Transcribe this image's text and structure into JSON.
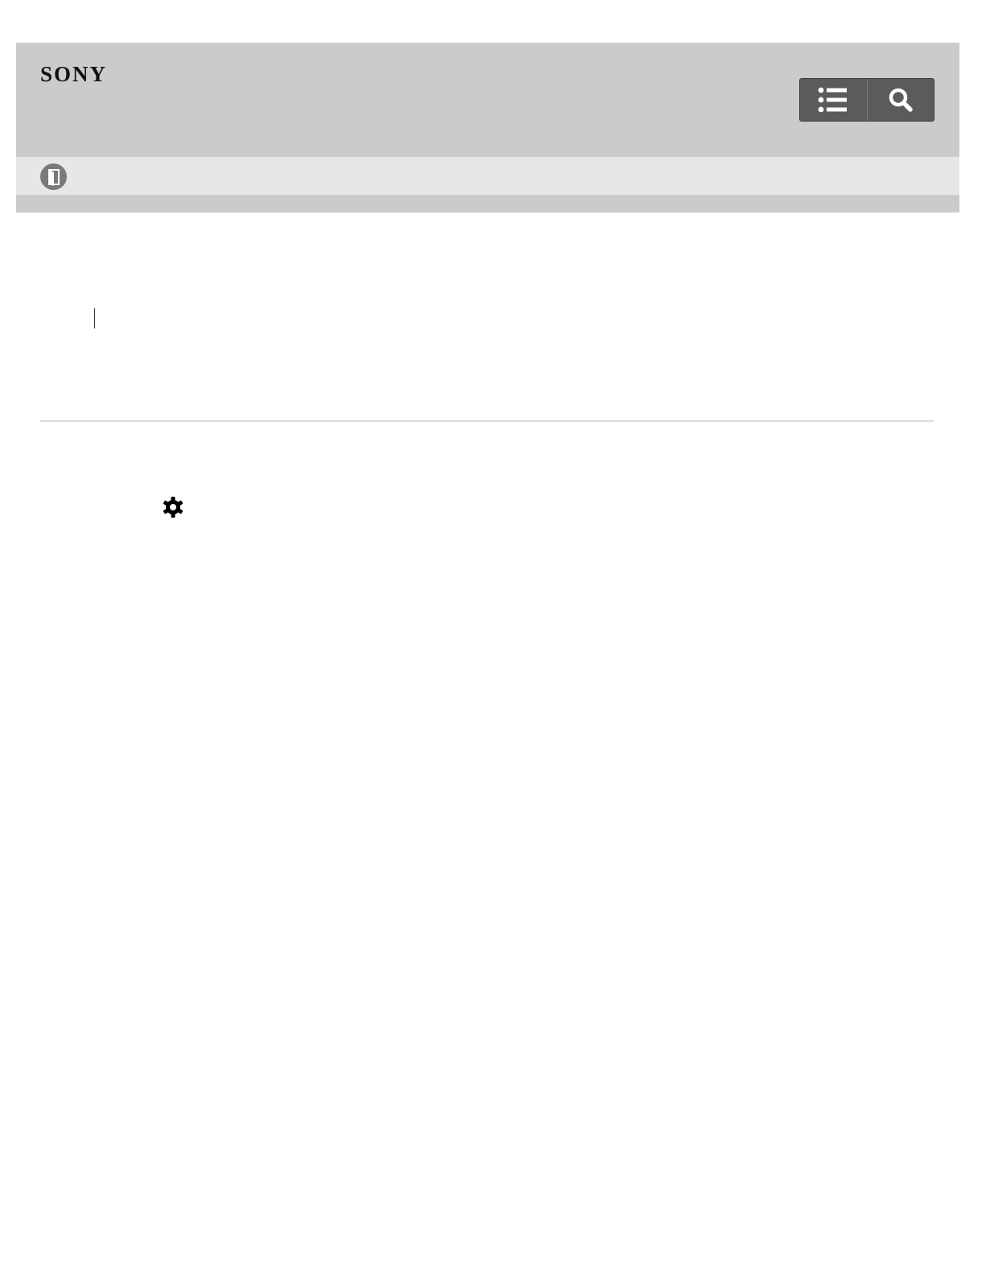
{
  "header": {
    "brand": "SONY"
  },
  "toolbar": {
    "buttons": [
      {
        "icon": "list-icon"
      },
      {
        "icon": "search-icon"
      }
    ]
  },
  "subbar": {
    "icon": "manual-book-icon"
  },
  "content": {
    "icon": "gear-icon"
  },
  "colors": {
    "header_bg": "#cbcbcb",
    "subbar_bg": "#e7e7e7",
    "toolbar_bg": "#5b5b5b"
  }
}
